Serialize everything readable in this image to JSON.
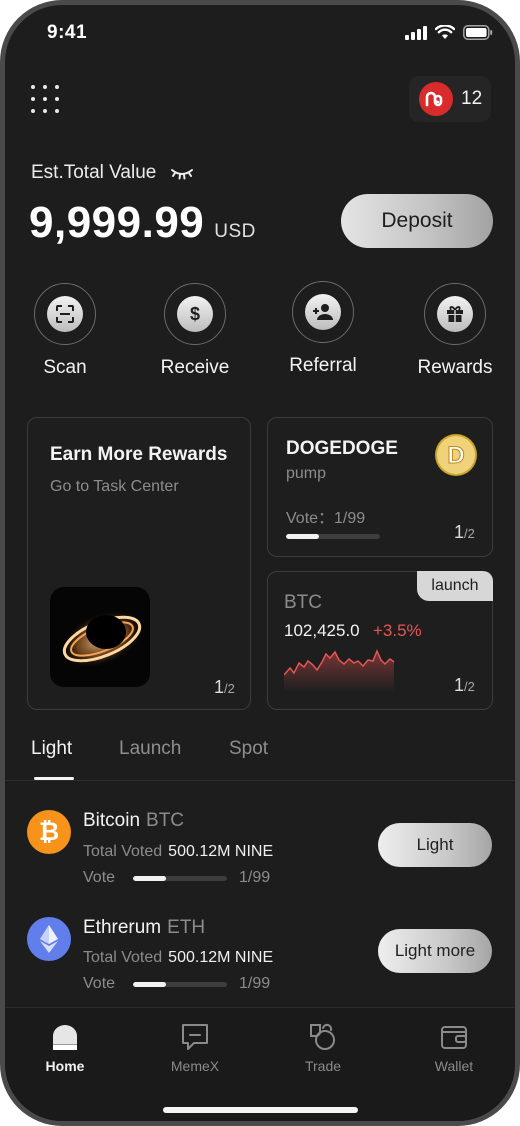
{
  "status_bar": {
    "time": "9:41"
  },
  "header": {
    "notification_count": "12"
  },
  "balance": {
    "label": "Est.Total Value",
    "amount": "9,999.99",
    "unit": "USD",
    "deposit_label": "Deposit"
  },
  "actions": [
    {
      "label": "Scan",
      "icon": "scan-icon"
    },
    {
      "label": "Receive",
      "icon": "dollar-icon"
    },
    {
      "label": "Referral",
      "icon": "add-user-icon"
    },
    {
      "label": "Rewards",
      "icon": "gift-icon"
    }
  ],
  "rewards_card": {
    "title": "Earn More Rewards",
    "subtitle": "Go to Task Center",
    "page": "1",
    "total": "/2"
  },
  "token_card": {
    "title": "DOGEDOGE",
    "subtitle": "pump",
    "vote_label": "Vote：1/99",
    "vote_progress": 0.35,
    "page": "1",
    "total": "/2"
  },
  "btc_card": {
    "tag": "launch",
    "symbol": "BTC",
    "price": "102,425.0",
    "change": "+3.5%",
    "change_color": "#e85454",
    "page": "1",
    "total": "/2"
  },
  "tabs": [
    {
      "label": "Light"
    },
    {
      "label": "Launch"
    },
    {
      "label": "Spot"
    }
  ],
  "list": [
    {
      "name": "Bitcoin",
      "symbol": "BTC",
      "voted_label": "Total Voted",
      "voted_value": "500.12M NINE",
      "vote_label": "Vote",
      "vote_count": "1/99",
      "vote_progress": 0.35,
      "button": "Light",
      "icon": "bitcoin-icon",
      "color": "#f7931a"
    },
    {
      "name": "Ethrerum",
      "symbol": "ETH",
      "voted_label": "Total Voted",
      "voted_value": "500.12M NINE",
      "vote_label": "Vote",
      "vote_count": "1/99",
      "vote_progress": 0.35,
      "button": "Light more",
      "icon": "ethereum-icon",
      "color": "#627eea"
    }
  ],
  "bottom_nav": [
    {
      "label": "Home"
    },
    {
      "label": "MemeX"
    },
    {
      "label": "Trade"
    },
    {
      "label": "Wallet"
    }
  ]
}
